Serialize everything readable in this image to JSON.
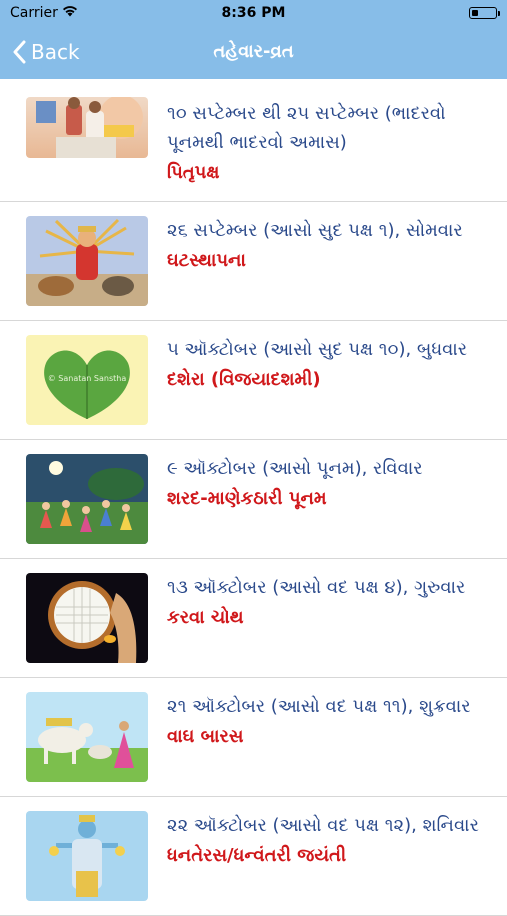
{
  "status_bar": {
    "carrier": "Carrier",
    "time": "8:36 PM",
    "battery_level": 0.25
  },
  "navbar": {
    "back_label": "Back",
    "title": "તહેવાર-વ્રત"
  },
  "festivals": [
    {
      "date": "૧૦ સપ્ટેમ્બર થી ૨૫ સપ્ટેમ્બર (ભાદરવો પૂનમથી ભાદરવો અમાસ)",
      "name": "પિતૃપક્ષ",
      "image": "pitru-paksha-image"
    },
    {
      "date": "૨૬ સપ્ટેમ્બર (આસો સુદ પક્ષ ૧), સોમવાર",
      "name": "ઘટસ્થાપના",
      "image": "ghatasthapana-image"
    },
    {
      "date": "૫ ઑક્ટોબર (આસો સુદ પક્ષ ૧૦), બુધવાર",
      "name": "દશેરા (વિજયાદશમી)",
      "image": "dussehra-leaf-image",
      "watermark": "© Sanatan Sanstha"
    },
    {
      "date": "૯ ઑક્ટોબર (આસો પૂનમ), રવિવાર",
      "name": "શરદ-માણેકઠારી પૂનમ",
      "image": "sharad-purnima-image"
    },
    {
      "date": "૧૩ ઑક્ટોબર (આસો વદ પક્ષ ૪), ગુરુવાર",
      "name": "કરવા ચોથ",
      "image": "karva-chauth-image"
    },
    {
      "date": "૨૧ ઑક્ટોબર (આસો વદ પક્ષ ૧૧), શુક્રવાર",
      "name": "વાઘ બારસ",
      "image": "vagh-baras-image"
    },
    {
      "date": "૨૨ ઑક્ટોબર (આસો વદ પક્ષ ૧૨), શનિવાર",
      "name": "ધનતેરસ/ધન્વંતરી જયંતી",
      "image": "dhanteras-image"
    }
  ]
}
